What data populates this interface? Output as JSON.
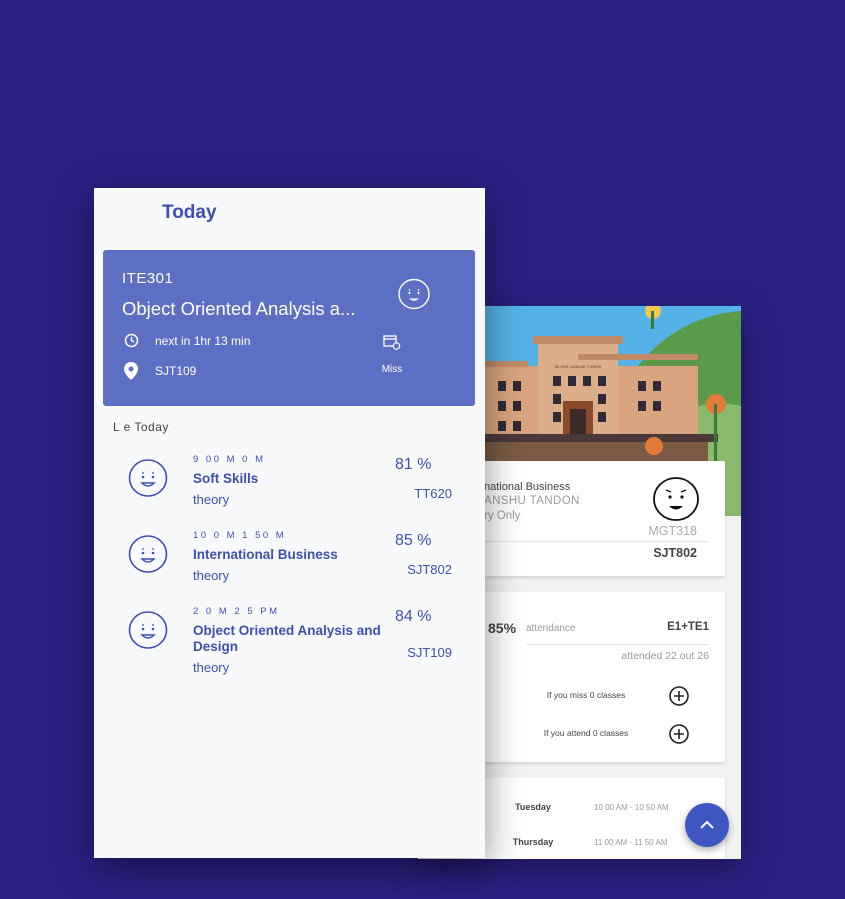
{
  "front": {
    "title": "Today",
    "current": {
      "code": "ITE301",
      "name": "Object Oriented Analysis a...",
      "next_text": "next in 1hr 13 min",
      "room": "SJT109",
      "miss_label": "Miss"
    },
    "later_label": "L  e  Today",
    "classes": [
      {
        "time": "9 00  M     0  M",
        "name": "Soft Skills",
        "type": "theory",
        "attendance": "81 %",
        "room": "TT620"
      },
      {
        "time": "10 0   M  1  50  M",
        "name": "International Business",
        "type": "theory",
        "attendance": "85 %",
        "room": "SJT802"
      },
      {
        "time": "2  0  M  2 5  PM",
        "name": "Object Oriented Analysis and Design",
        "type": "theory",
        "attendance": "84 %",
        "room": "SJT109"
      }
    ]
  },
  "back": {
    "course": {
      "title": "national Business",
      "faculty": "ANSHU TANDON",
      "type": "ry Only",
      "code": "MGT318",
      "room": "SJT802"
    },
    "attendance": {
      "percent": "85%",
      "label": "attendance",
      "slot": "E1+TE1",
      "count": "attended 22 out 26",
      "miss_text": "If you miss 0 classes",
      "attend_text": "If you attend 0 classes"
    },
    "schedule": [
      {
        "day": "Tuesday",
        "time": "10 00 AM - 10 50 AM"
      },
      {
        "day": "Thursday",
        "time": "11 00 AM - 11 50 AM"
      }
    ],
    "building_sign": "SILVER JUBILEE TOWER"
  },
  "colors": {
    "background": "#2b2184",
    "accent": "#3f4fb0",
    "hero": "#5c6fc3",
    "fab": "#3d56c2"
  },
  "icons": [
    "face-icon",
    "clock-icon",
    "location-pin-icon",
    "calendar-icon",
    "plus-circle-icon",
    "chevron-up-icon"
  ]
}
